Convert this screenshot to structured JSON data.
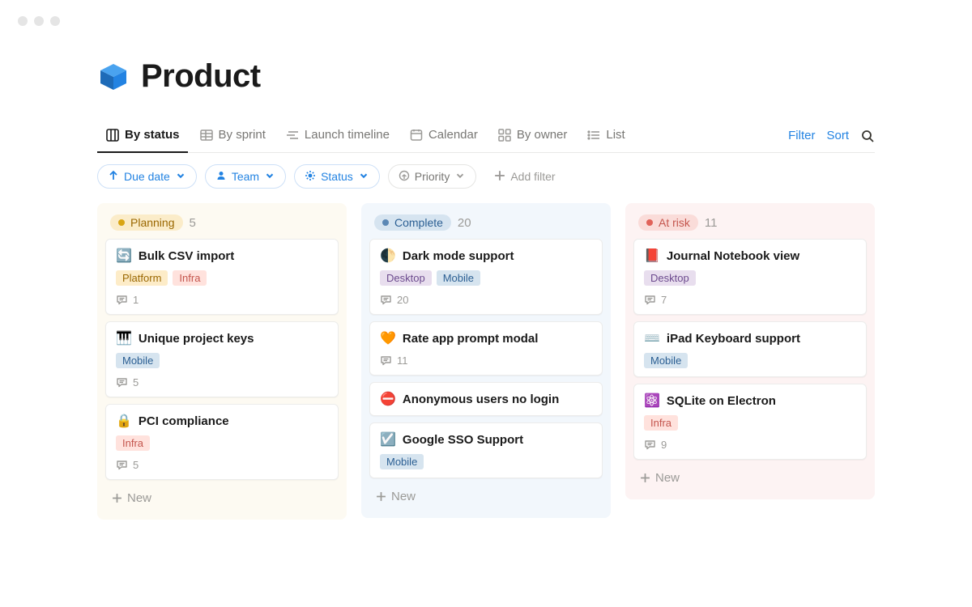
{
  "page": {
    "title": "Product"
  },
  "views": {
    "tabs": [
      {
        "label": "By status"
      },
      {
        "label": "By sprint"
      },
      {
        "label": "Launch timeline"
      },
      {
        "label": "Calendar"
      },
      {
        "label": "By owner"
      },
      {
        "label": "List"
      }
    ],
    "filter_link": "Filter",
    "sort_link": "Sort"
  },
  "filters": {
    "due_date": "Due date",
    "team": "Team",
    "status": "Status",
    "priority": "Priority",
    "add_filter": "Add filter"
  },
  "columns": [
    {
      "key": "planning",
      "label": "Planning",
      "count": "5",
      "cards": [
        {
          "icon": "🔄",
          "title": "Bulk CSV import",
          "tags": [
            {
              "t": "Platform",
              "c": "platform"
            },
            {
              "t": "Infra",
              "c": "infra"
            }
          ],
          "comments": "1"
        },
        {
          "icon": "🎹",
          "title": "Unique project keys",
          "tags": [
            {
              "t": "Mobile",
              "c": "mobile"
            }
          ],
          "comments": "5"
        },
        {
          "icon": "🔒",
          "title": "PCI compliance",
          "tags": [
            {
              "t": "Infra",
              "c": "infra"
            }
          ],
          "comments": "5"
        }
      ],
      "new_label": "New"
    },
    {
      "key": "complete",
      "label": "Complete",
      "count": "20",
      "cards": [
        {
          "icon": "🌓",
          "title": "Dark mode support",
          "tags": [
            {
              "t": "Desktop",
              "c": "desktop"
            },
            {
              "t": "Mobile",
              "c": "mobile"
            }
          ],
          "comments": "20"
        },
        {
          "icon": "🧡",
          "title": "Rate app prompt modal",
          "tags": [],
          "comments": "11"
        },
        {
          "icon": "⛔",
          "title": "Anonymous users no login",
          "tags": [],
          "comments": ""
        },
        {
          "icon": "☑️",
          "title": "Google SSO Support",
          "tags": [
            {
              "t": "Mobile",
              "c": "mobile"
            }
          ],
          "comments": ""
        }
      ],
      "new_label": "New"
    },
    {
      "key": "atrisk",
      "label": "At risk",
      "count": "11",
      "cards": [
        {
          "icon": "📕",
          "title": "Journal Notebook view",
          "tags": [
            {
              "t": "Desktop",
              "c": "desktop"
            }
          ],
          "comments": "7"
        },
        {
          "icon": "⌨️",
          "title": "iPad Keyboard support",
          "tags": [
            {
              "t": "Mobile",
              "c": "mobile"
            }
          ],
          "comments": ""
        },
        {
          "icon": "⚛️",
          "title": "SQLite on Electron",
          "tags": [
            {
              "t": "Infra",
              "c": "infra"
            }
          ],
          "comments": "9"
        }
      ],
      "new_label": "New"
    }
  ]
}
